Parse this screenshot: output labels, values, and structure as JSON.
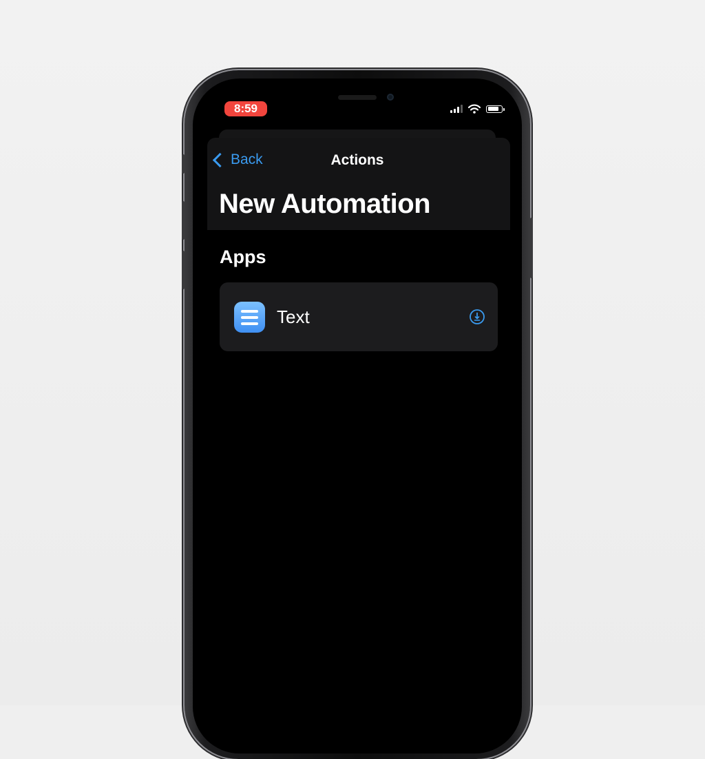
{
  "status_bar": {
    "time": "8:59"
  },
  "nav": {
    "back_label": "Back",
    "title": "Actions"
  },
  "page": {
    "large_title": "New Automation"
  },
  "sections": [
    {
      "header": "Apps",
      "items": [
        {
          "label": "Text",
          "icon": "text-app-icon",
          "accessory_icon": "download-icon"
        }
      ]
    }
  ],
  "colors": {
    "accent": "#3a9bf0",
    "time_pill": "#f2453d",
    "background": "#000000",
    "row_background": "#1c1c1e"
  },
  "status": {
    "battery_level": 0.8
  }
}
